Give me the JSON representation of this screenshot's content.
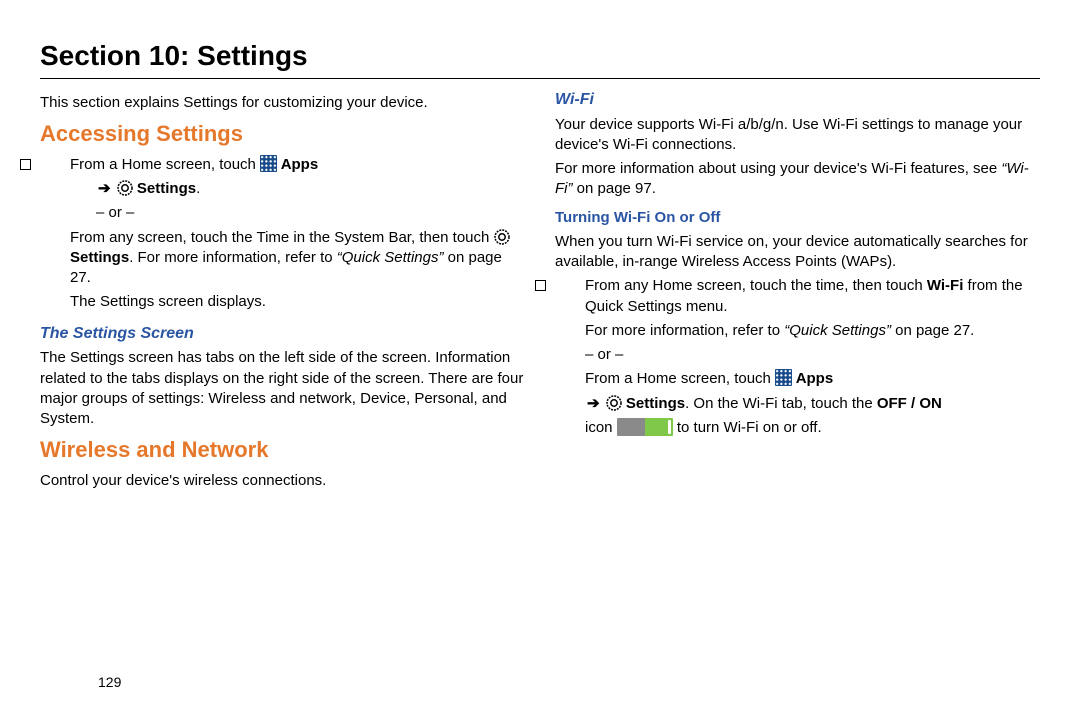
{
  "section_title": "Section 10: Settings",
  "page_number": "129",
  "left": {
    "intro": "This section explains Settings for customizing your device.",
    "h_accessing": "Accessing Settings",
    "b1_pre": "From a Home screen, touch ",
    "b1_apps": " Apps",
    "b1_line2_arrow": "➔",
    "b1_line2_settings": " Settings",
    "b1_line2_end": ".",
    "or": "– or –",
    "p2a": "From any screen, touch the Time in the System Bar, then touch ",
    "p2_settings": " Settings",
    "p2b": ". For more information, refer to ",
    "p2_ref": "“Quick Settings”",
    "p2c": " on page 27.",
    "p3": "The Settings screen displays.",
    "h_settings_screen": "The Settings Screen",
    "p4": "The Settings screen has tabs on the left side of the screen. Information related to the tabs displays on the right side of the screen. There are four major groups of settings: Wireless and network, Device, Personal, and System.",
    "h_wireless": "Wireless and Network",
    "p5": "Control your device's wireless connections."
  },
  "right": {
    "h_wifi": "Wi-Fi",
    "p1": "Your device supports Wi-Fi a/b/g/n. Use Wi-Fi settings to manage your device's Wi-Fi connections.",
    "p2a": "For more information about using your device's Wi-Fi features, see ",
    "p2_ref": "“Wi-Fi”",
    "p2b": " on page 97.",
    "h_turning": "Turning Wi-Fi On or Off",
    "p3": "When you turn Wi-Fi service on, your device automatically searches for available, in-range Wireless Access Points (WAPs).",
    "b1a": "From any Home screen, touch the time, then touch ",
    "b1b": "Wi-Fi",
    "b1c": " from the Quick Settings menu.",
    "p4a": "For more information, refer to ",
    "p4_ref": "“Quick Settings”",
    "p4b": " on page 27.",
    "or": "– or –",
    "p5_pre": "From a Home screen, touch ",
    "p5_apps": " Apps",
    "p6_arrow": "➔",
    "p6_settings": " Settings",
    "p6_mid": ". On the Wi-Fi tab, touch the ",
    "p6_offon": "OFF / ON",
    "p7a": "icon ",
    "p7b": " to turn Wi-Fi on or off."
  }
}
